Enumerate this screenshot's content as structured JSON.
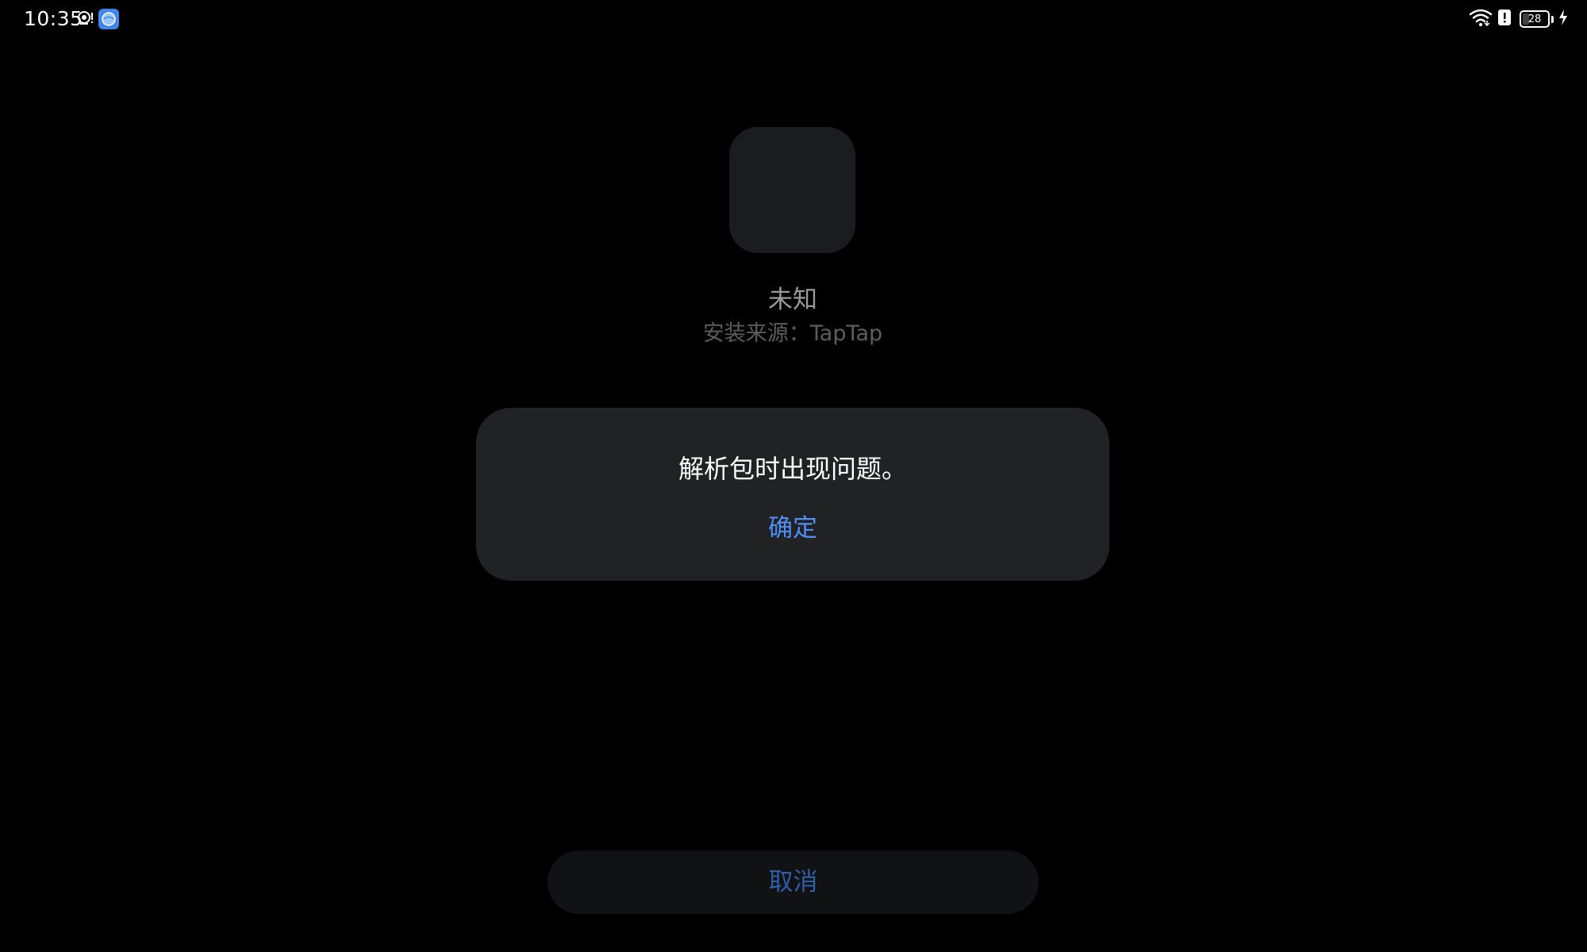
{
  "status_bar": {
    "time": "10:35",
    "battery_level": "28",
    "battery_fraction": 0.28,
    "icons": [
      "camera-notification-icon",
      "browser-app-icon",
      "wifi-icon",
      "alert-icon",
      "battery-icon",
      "charging-icon"
    ]
  },
  "app": {
    "name": "未知",
    "install_source": "安装来源：TapTap"
  },
  "dialog": {
    "message": "解析包时出现问题。",
    "confirm_label": "确定"
  },
  "footer": {
    "cancel_label": "取消"
  },
  "colors": {
    "background": "#000000",
    "dialog_bg": "#212224",
    "accent_blue": "#4f8ff5",
    "cancel_text": "#2f5ea7",
    "app_name_text": "#9a9a9a",
    "source_text": "#5d5d5d"
  }
}
